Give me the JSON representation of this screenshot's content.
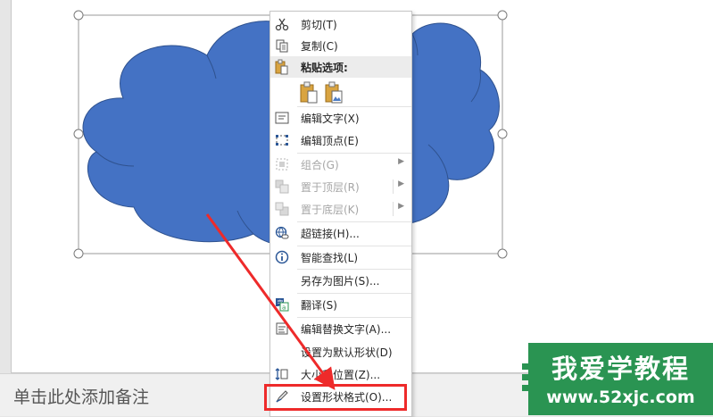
{
  "notes_placeholder": "单击此处添加备注",
  "context_menu": {
    "cut": "剪切(T)",
    "copy": "复制(C)",
    "paste_options": "粘贴选项:",
    "edit_text": "编辑文字(X)",
    "edit_points": "编辑顶点(E)",
    "group": "组合(G)",
    "bring_to_front": "置于顶层(R)",
    "send_to_back": "置于底层(K)",
    "hyperlink": "超链接(H)...",
    "smart_lookup": "智能查找(L)",
    "save_as_picture": "另存为图片(S)...",
    "translate": "翻译(S)",
    "edit_alt_text": "编辑替换文字(A)...",
    "set_default_shape": "设置为默认形状(D)",
    "size_position": "大小和位置(Z)...",
    "format_shape": "设置形状格式(O)..."
  },
  "watermark": {
    "title": "我爱学教程",
    "url": "www.52xjc.com"
  },
  "colors": {
    "cloud_fill": "#4472c4",
    "cloud_stroke": "#2f528f",
    "annotation_red": "#ee2a2a",
    "watermark_green": "#2a9452"
  }
}
